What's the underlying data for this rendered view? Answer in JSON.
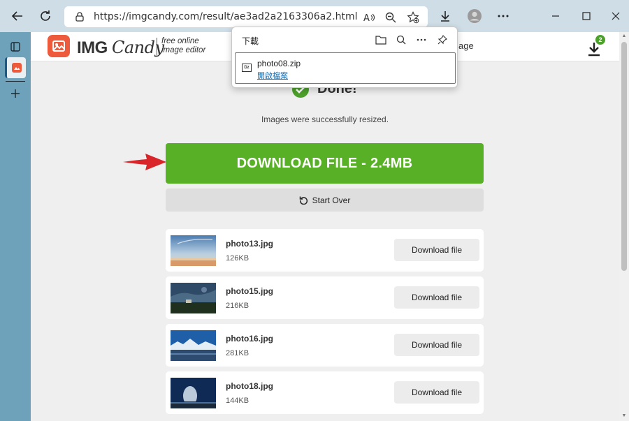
{
  "browser": {
    "url": "https://imgcandy.com/result/ae3ad2a2163306a2.html"
  },
  "downloads_flyout": {
    "title": "下載",
    "file_name": "photo08.zip",
    "file_icon_text": "Dz",
    "open_link": "開啟檔案"
  },
  "site": {
    "logo_img": "IMG",
    "logo_candy": "Candy",
    "tagline_line1": "free online",
    "tagline_line2": "image editor",
    "nav_fragment": "age",
    "download_badge": "2"
  },
  "result": {
    "title": "Done!",
    "subtitle": "Images were successfully resized.",
    "download_all_label": "DOWNLOAD FILE - 2.4MB",
    "start_over_label": "Start Over"
  },
  "files": [
    {
      "name": "photo13.jpg",
      "size": "126KB",
      "button": "Download file"
    },
    {
      "name": "photo15.jpg",
      "size": "216KB",
      "button": "Download file"
    },
    {
      "name": "photo16.jpg",
      "size": "281KB",
      "button": "Download file"
    },
    {
      "name": "photo18.jpg",
      "size": "144KB",
      "button": "Download file"
    }
  ],
  "colors": {
    "accent_green": "#58b026",
    "logo_orange": "#ee5b3c",
    "sidebar_blue": "#6ea2ba",
    "arrow_red": "#d9252a"
  }
}
